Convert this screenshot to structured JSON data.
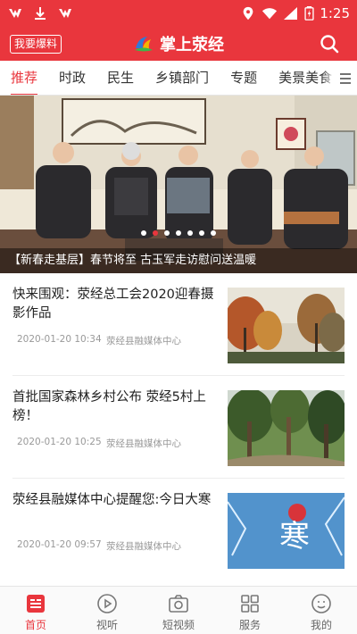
{
  "status_bar": {
    "time": "1:25"
  },
  "header": {
    "baoliao_label": "我要爆料",
    "app_name": "掌上荥经"
  },
  "tabs": [
    "推荐",
    "时政",
    "民生",
    "乡镇部门",
    "专题",
    "美景美食"
  ],
  "banner": {
    "caption": "【新春走基层】春节将至 古玉军走访慰问送温暖",
    "slide_count": 7,
    "active_slide": 1
  },
  "news": [
    {
      "title": "快来围观：荥经总工会2020迎春摄影作品",
      "date": "2020-01-20 10:34",
      "source": "荥经县融媒体中心"
    },
    {
      "title": "首批国家森林乡村公布 荥经5村上榜！",
      "date": "2020-01-20 10:25",
      "source": "荥经县融媒体中心"
    },
    {
      "title": "荥经县融媒体中心提醒您:今日大寒",
      "date": "2020-01-20 09:57",
      "source": "荥经县融媒体中心"
    }
  ],
  "thumb_texts": {
    "winter_char": "寒"
  },
  "bottom_nav": [
    {
      "label": "首页",
      "icon": "home-icon",
      "active": true
    },
    {
      "label": "视听",
      "icon": "play-icon",
      "active": false
    },
    {
      "label": "短视频",
      "icon": "camera-icon",
      "active": false
    },
    {
      "label": "服务",
      "icon": "grid-icon",
      "active": false
    },
    {
      "label": "我的",
      "icon": "user-icon",
      "active": false
    }
  ],
  "colors": {
    "brand_red": "#e9363d"
  }
}
